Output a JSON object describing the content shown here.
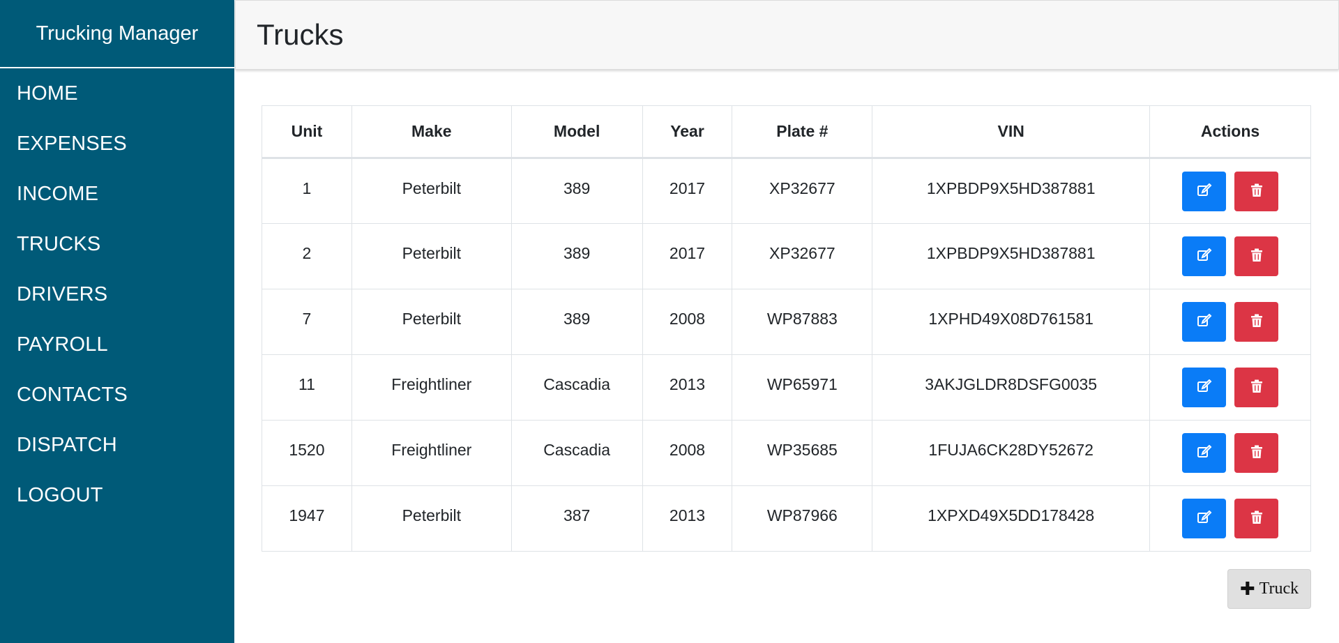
{
  "app": {
    "brand": "Trucking Manager"
  },
  "sidebar": {
    "items": [
      {
        "label": "HOME"
      },
      {
        "label": "EXPENSES"
      },
      {
        "label": "INCOME"
      },
      {
        "label": "TRUCKS"
      },
      {
        "label": "DRIVERS"
      },
      {
        "label": "PAYROLL"
      },
      {
        "label": "CONTACTS"
      },
      {
        "label": "DISPATCH"
      },
      {
        "label": "LOGOUT"
      }
    ]
  },
  "header": {
    "title": "Trucks"
  },
  "table": {
    "columns": [
      "Unit",
      "Make",
      "Model",
      "Year",
      "Plate #",
      "VIN",
      "Actions"
    ],
    "rows": [
      {
        "unit": "1",
        "make": "Peterbilt",
        "model": "389",
        "year": "2017",
        "plate": "XP32677",
        "vin": "1XPBDP9X5HD387881"
      },
      {
        "unit": "2",
        "make": "Peterbilt",
        "model": "389",
        "year": "2017",
        "plate": "XP32677",
        "vin": "1XPBDP9X5HD387881"
      },
      {
        "unit": "7",
        "make": "Peterbilt",
        "model": "389",
        "year": "2008",
        "plate": "WP87883",
        "vin": "1XPHD49X08D761581"
      },
      {
        "unit": "11",
        "make": "Freightliner",
        "model": "Cascadia",
        "year": "2013",
        "plate": "WP65971",
        "vin": "3AKJGLDR8DSFG0035"
      },
      {
        "unit": "1520",
        "make": "Freightliner",
        "model": "Cascadia",
        "year": "2008",
        "plate": "WP35685",
        "vin": "1FUJA6CK28DY52672"
      },
      {
        "unit": "1947",
        "make": "Peterbilt",
        "model": "387",
        "year": "2013",
        "plate": "WP87966",
        "vin": "1XPXD49X5DD178428"
      }
    ],
    "icons": {
      "edit": "edit-icon",
      "delete": "trash-icon"
    }
  },
  "add_button": {
    "label": "Truck",
    "icon": "plus-icon"
  },
  "colors": {
    "sidebar": "#005a78",
    "edit_button": "#0a7cf7",
    "delete_button": "#dc3545",
    "header_bg": "#f7f7f7"
  }
}
